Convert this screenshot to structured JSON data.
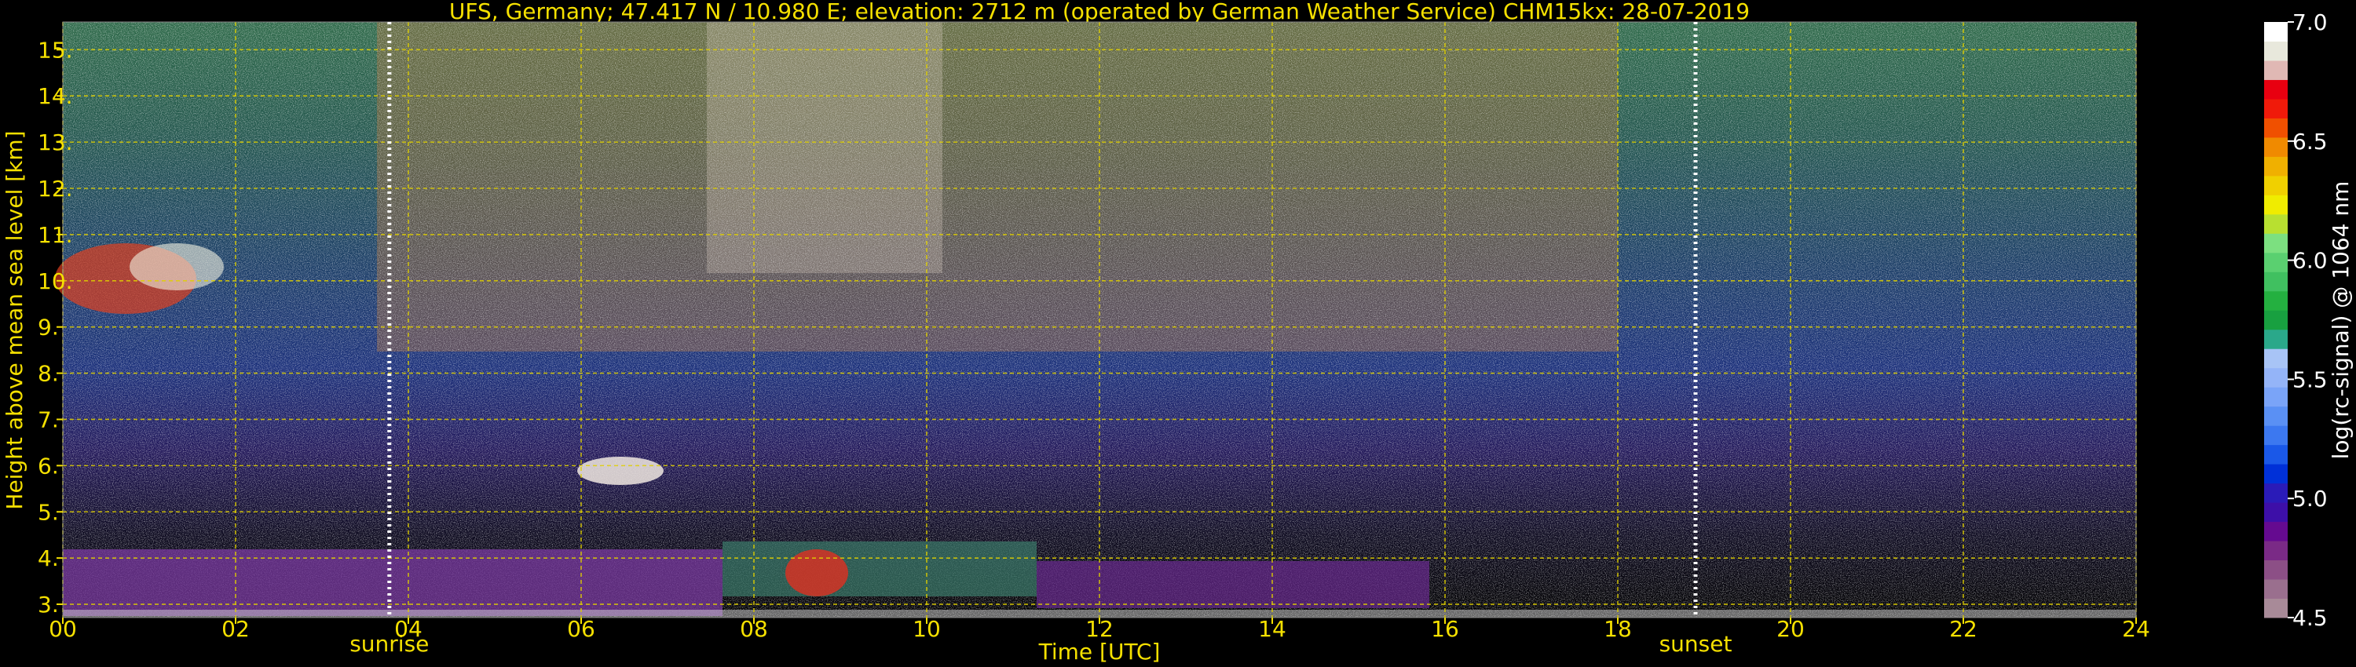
{
  "chart_data": {
    "type": "heatmap",
    "title": "UFS, Germany; 47.417 N / 10.980 E; elevation: 2712 m  (operated by German Weather Service)    CHM15kx: 28-07-2019",
    "xlabel": "Time [UTC]",
    "ylabel": "Height above mean sea level [km]",
    "xlim": [
      0,
      24
    ],
    "ylim": [
      2.712,
      15.6
    ],
    "x_ticks": [
      "00",
      "02",
      "04",
      "06",
      "08",
      "10",
      "12",
      "14",
      "16",
      "18",
      "20",
      "22",
      "24"
    ],
    "y_ticks": [
      "3.",
      "4.",
      "5.",
      "6.",
      "7.",
      "8.",
      "9.",
      "10.",
      "11.",
      "12.",
      "13.",
      "14.",
      "15."
    ],
    "grid": true,
    "markers": [
      {
        "label": "sunrise",
        "time": 3.78
      },
      {
        "label": "sunset",
        "time": 18.9
      }
    ],
    "colorbar": {
      "label": "log(rc-signal) @ 1064 nm",
      "range": [
        4.5,
        7.0
      ],
      "ticks": [
        "4.5",
        "5.0",
        "5.5",
        "6.0",
        "6.5",
        "7.0"
      ],
      "colors": [
        "#a88a98",
        "#9a6f8e",
        "#8c4f86",
        "#7a2a86",
        "#650a90",
        "#3d0fa8",
        "#2a1bb8",
        "#0030d8",
        "#1a58e8",
        "#3c78f0",
        "#5a90f4",
        "#7aa4f8",
        "#94b4f8",
        "#a8c4f6",
        "#2aa88a",
        "#18a040",
        "#24b040",
        "#40c060",
        "#5ad070",
        "#7ce080",
        "#b8e030",
        "#f0ec00",
        "#f0d000",
        "#f0b000",
        "#f08a00",
        "#f05000",
        "#f01a0a",
        "#e80010",
        "#e0b8b4",
        "#e8e8dc",
        "#ffffff"
      ]
    }
  },
  "colors": {
    "text": "#f5e000",
    "grid": "#e0d000",
    "marker": "#ffffff",
    "background": "#000000"
  }
}
